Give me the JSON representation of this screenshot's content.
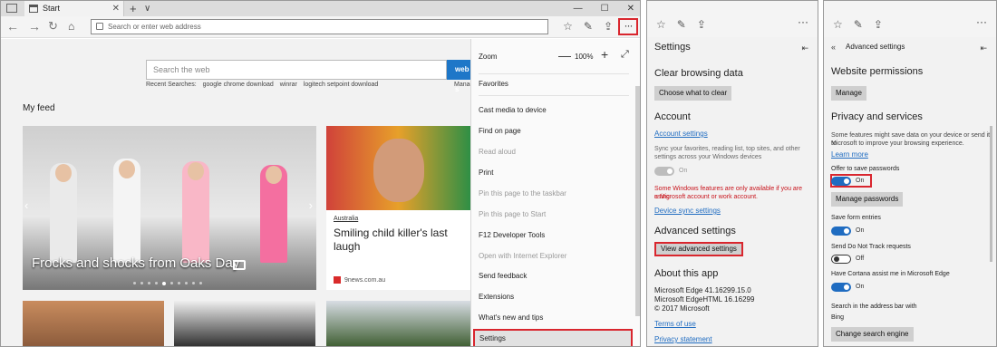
{
  "browser": {
    "tab_title": "Start",
    "address_placeholder": "Search or enter web address",
    "search_placeholder": "Search the web",
    "search_button": "web s",
    "recent_label": "Recent Searches:",
    "recent": [
      "google chrome download",
      "winrar",
      "logitech setpoint download"
    ],
    "manage_link": "Manag",
    "feed_title": "My feed",
    "card1_title": "Frocks and shocks from Oaks Day",
    "card2_category": "Australia",
    "card2_title": "Smiling child killer's last laugh",
    "card2_source": "9news.com.au",
    "accent": "#1e77c8",
    "highlight": "#d9262e"
  },
  "menu": {
    "zoom_label": "Zoom",
    "zoom_value": "100%",
    "items": [
      {
        "label": "Favorites",
        "disabled": false
      },
      {
        "label": "Cast media to device",
        "disabled": false
      },
      {
        "label": "Find on page",
        "disabled": false
      },
      {
        "label": "Read aloud",
        "disabled": true
      },
      {
        "label": "Print",
        "disabled": false
      },
      {
        "label": "Pin this page to the taskbar",
        "disabled": true
      },
      {
        "label": "Pin this page to Start",
        "disabled": true
      },
      {
        "label": "F12 Developer Tools",
        "disabled": false
      },
      {
        "label": "Open with Internet Explorer",
        "disabled": true
      },
      {
        "label": "Send feedback",
        "disabled": false
      },
      {
        "label": "Extensions",
        "disabled": false
      },
      {
        "label": "What's new and tips",
        "disabled": false
      }
    ],
    "settings": "Settings"
  },
  "settings": {
    "title": "Settings",
    "clear_heading": "Clear browsing data",
    "clear_button": "Choose what to clear",
    "account_heading": "Account",
    "account_link": "Account settings",
    "sync_text_1": "Sync your favorites, reading list, top sites, and other",
    "sync_text_2": "settings across your Windows devices",
    "sync_toggle": "On",
    "warn_1": "Some Windows features are only available if you are using",
    "warn_2": "a Microsoft account or work account.",
    "device_sync_link": "Device sync settings",
    "advanced_heading": "Advanced settings",
    "advanced_button": "View advanced settings",
    "about_heading": "About this app",
    "edge_version": "Microsoft Edge 41.16299.15.0",
    "edgehtml_version": "Microsoft EdgeHTML 16.16299",
    "copyright": "© 2017 Microsoft",
    "terms_link": "Terms of use",
    "privacy_link": "Privacy statement"
  },
  "advanced": {
    "title": "Advanced settings",
    "permissions_heading": "Website permissions",
    "manage_button": "Manage",
    "privacy_heading": "Privacy and services",
    "privacy_text_1": "Some features might save data on your device or send it to",
    "privacy_text_2": "Microsoft to improve your browsing experience.",
    "learn_more": "Learn more",
    "offer_passwords": "Offer to save passwords",
    "offer_toggle": "On",
    "manage_passwords": "Manage passwords",
    "save_form": "Save form entries",
    "save_form_toggle": "On",
    "dnt": "Send Do Not Track requests",
    "dnt_toggle": "Off",
    "cortana": "Have Cortana assist me in Microsoft Edge",
    "cortana_toggle": "On",
    "search_with": "Search in the address bar with",
    "search_engine": "Bing",
    "change_engine": "Change search engine"
  }
}
